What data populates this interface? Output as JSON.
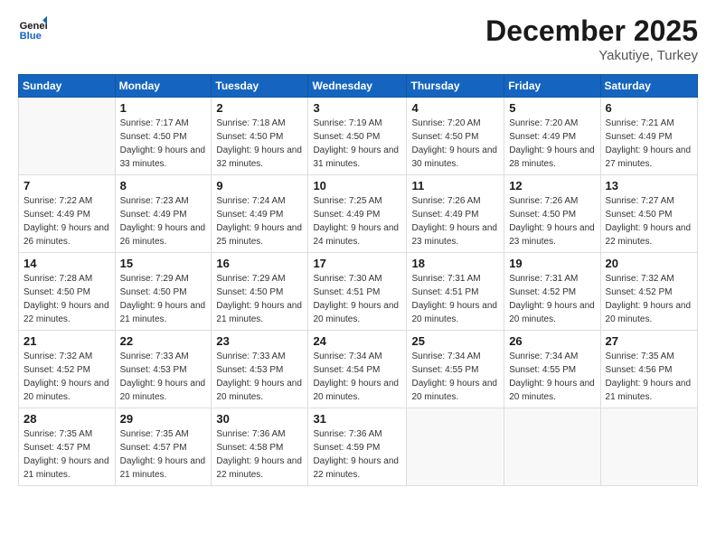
{
  "logo": {
    "line1": "General",
    "line2": "Blue"
  },
  "title": "December 2025",
  "subtitle": "Yakutiye, Turkey",
  "weekdays": [
    "Sunday",
    "Monday",
    "Tuesday",
    "Wednesday",
    "Thursday",
    "Friday",
    "Saturday"
  ],
  "weeks": [
    [
      {
        "day": "",
        "empty": true
      },
      {
        "day": "1",
        "sunrise": "7:17 AM",
        "sunset": "4:50 PM",
        "daylight": "9 hours and 33 minutes."
      },
      {
        "day": "2",
        "sunrise": "7:18 AM",
        "sunset": "4:50 PM",
        "daylight": "9 hours and 32 minutes."
      },
      {
        "day": "3",
        "sunrise": "7:19 AM",
        "sunset": "4:50 PM",
        "daylight": "9 hours and 31 minutes."
      },
      {
        "day": "4",
        "sunrise": "7:20 AM",
        "sunset": "4:50 PM",
        "daylight": "9 hours and 30 minutes."
      },
      {
        "day": "5",
        "sunrise": "7:20 AM",
        "sunset": "4:49 PM",
        "daylight": "9 hours and 28 minutes."
      },
      {
        "day": "6",
        "sunrise": "7:21 AM",
        "sunset": "4:49 PM",
        "daylight": "9 hours and 27 minutes."
      }
    ],
    [
      {
        "day": "7",
        "sunrise": "7:22 AM",
        "sunset": "4:49 PM",
        "daylight": "9 hours and 26 minutes."
      },
      {
        "day": "8",
        "sunrise": "7:23 AM",
        "sunset": "4:49 PM",
        "daylight": "9 hours and 26 minutes."
      },
      {
        "day": "9",
        "sunrise": "7:24 AM",
        "sunset": "4:49 PM",
        "daylight": "9 hours and 25 minutes."
      },
      {
        "day": "10",
        "sunrise": "7:25 AM",
        "sunset": "4:49 PM",
        "daylight": "9 hours and 24 minutes."
      },
      {
        "day": "11",
        "sunrise": "7:26 AM",
        "sunset": "4:49 PM",
        "daylight": "9 hours and 23 minutes."
      },
      {
        "day": "12",
        "sunrise": "7:26 AM",
        "sunset": "4:50 PM",
        "daylight": "9 hours and 23 minutes."
      },
      {
        "day": "13",
        "sunrise": "7:27 AM",
        "sunset": "4:50 PM",
        "daylight": "9 hours and 22 minutes."
      }
    ],
    [
      {
        "day": "14",
        "sunrise": "7:28 AM",
        "sunset": "4:50 PM",
        "daylight": "9 hours and 22 minutes."
      },
      {
        "day": "15",
        "sunrise": "7:29 AM",
        "sunset": "4:50 PM",
        "daylight": "9 hours and 21 minutes."
      },
      {
        "day": "16",
        "sunrise": "7:29 AM",
        "sunset": "4:50 PM",
        "daylight": "9 hours and 21 minutes."
      },
      {
        "day": "17",
        "sunrise": "7:30 AM",
        "sunset": "4:51 PM",
        "daylight": "9 hours and 20 minutes."
      },
      {
        "day": "18",
        "sunrise": "7:31 AM",
        "sunset": "4:51 PM",
        "daylight": "9 hours and 20 minutes."
      },
      {
        "day": "19",
        "sunrise": "7:31 AM",
        "sunset": "4:52 PM",
        "daylight": "9 hours and 20 minutes."
      },
      {
        "day": "20",
        "sunrise": "7:32 AM",
        "sunset": "4:52 PM",
        "daylight": "9 hours and 20 minutes."
      }
    ],
    [
      {
        "day": "21",
        "sunrise": "7:32 AM",
        "sunset": "4:52 PM",
        "daylight": "9 hours and 20 minutes."
      },
      {
        "day": "22",
        "sunrise": "7:33 AM",
        "sunset": "4:53 PM",
        "daylight": "9 hours and 20 minutes."
      },
      {
        "day": "23",
        "sunrise": "7:33 AM",
        "sunset": "4:53 PM",
        "daylight": "9 hours and 20 minutes."
      },
      {
        "day": "24",
        "sunrise": "7:34 AM",
        "sunset": "4:54 PM",
        "daylight": "9 hours and 20 minutes."
      },
      {
        "day": "25",
        "sunrise": "7:34 AM",
        "sunset": "4:55 PM",
        "daylight": "9 hours and 20 minutes."
      },
      {
        "day": "26",
        "sunrise": "7:34 AM",
        "sunset": "4:55 PM",
        "daylight": "9 hours and 20 minutes."
      },
      {
        "day": "27",
        "sunrise": "7:35 AM",
        "sunset": "4:56 PM",
        "daylight": "9 hours and 21 minutes."
      }
    ],
    [
      {
        "day": "28",
        "sunrise": "7:35 AM",
        "sunset": "4:57 PM",
        "daylight": "9 hours and 21 minutes."
      },
      {
        "day": "29",
        "sunrise": "7:35 AM",
        "sunset": "4:57 PM",
        "daylight": "9 hours and 21 minutes."
      },
      {
        "day": "30",
        "sunrise": "7:36 AM",
        "sunset": "4:58 PM",
        "daylight": "9 hours and 22 minutes."
      },
      {
        "day": "31",
        "sunrise": "7:36 AM",
        "sunset": "4:59 PM",
        "daylight": "9 hours and 22 minutes."
      },
      {
        "day": "",
        "empty": true
      },
      {
        "day": "",
        "empty": true
      },
      {
        "day": "",
        "empty": true
      }
    ]
  ],
  "labels": {
    "sunrise": "Sunrise:",
    "sunset": "Sunset:",
    "daylight": "Daylight:"
  }
}
